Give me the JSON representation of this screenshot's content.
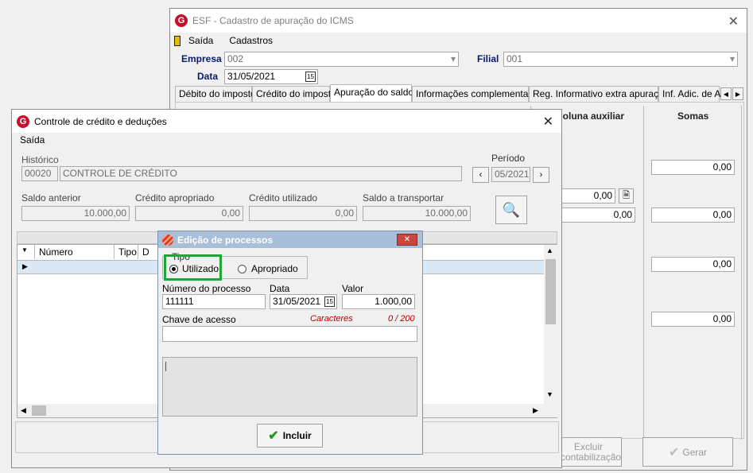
{
  "bg_window": {
    "title": "ESF - Cadastro de apuração do ICMS",
    "menu": [
      "Saída",
      "Cadastros"
    ],
    "empresa_label": "Empresa",
    "empresa_value": "002",
    "filial_label": "Filial",
    "filial_value": "001",
    "data_label": "Data",
    "data_value": "31/05/2021",
    "tabs": [
      "Débito do imposto",
      "Crédito do imposto",
      "Apuração do saldo",
      "Informações complementares",
      "Reg. Informativo extra apuração",
      "Inf. Adic. de A"
    ],
    "active_tab": "Apuração do saldo",
    "col_aux": "Coluna auxiliar",
    "col_somas": "Somas",
    "aux_values": [
      "0,00",
      "0,00"
    ],
    "somas_values": [
      "0,00",
      "0,00",
      "0,00",
      "0,00"
    ],
    "excluir_label": "Excluir contabilização",
    "gerar_label": "Gerar"
  },
  "credit_window": {
    "title": "Controle de crédito e deduções",
    "menu": "Saída",
    "historico_label": "Histórico",
    "historico_code": "00020",
    "historico_text": "CONTROLE DE CRÉDITO",
    "periodo_label": "Período",
    "periodo_value": "05/2021",
    "saldo_anterior_label": "Saldo anterior",
    "saldo_anterior": "10.000,00",
    "credito_apropriado_label": "Crédito apropriado",
    "credito_apropriado": "0,00",
    "credito_utilizado_label": "Crédito utilizado",
    "credito_utilizado": "0,00",
    "saldo_transportar_label": "Saldo a transportar",
    "saldo_transportar": "10.000,00",
    "grid_columns": [
      "Número",
      "Tipo",
      "D"
    ]
  },
  "dialog": {
    "title": "Edição de processos",
    "tipo_label": "Tipo",
    "opt_utilizado": "Utilizado",
    "opt_apropriado": "Apropriado",
    "selected": "Utilizado",
    "numero_label": "Número do processo",
    "numero_value": "111111",
    "data_label": "Data",
    "data_value": "31/05/2021",
    "valor_label": "Valor",
    "valor_value": "1.000,00",
    "chave_label": "Chave de acesso",
    "caracteres_label": "Caracteres",
    "caracteres_count": "0  / 200",
    "incluir_label": "Incluir"
  },
  "colors": {
    "dialog_title_bg": "#a9bed8",
    "highlight_green": "#1fa53a",
    "caracteres_red": "#b30000"
  }
}
